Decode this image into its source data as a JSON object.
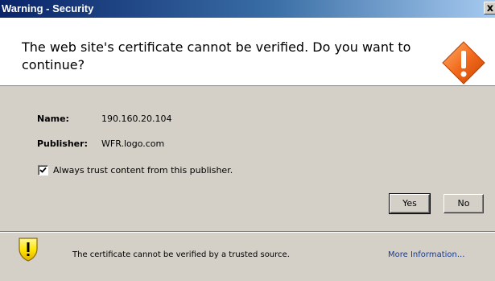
{
  "window": {
    "title": "Warning - Security",
    "close_label": "x"
  },
  "header": {
    "message": "The web site's certificate cannot be verified.  Do you want to continue?",
    "icon": "warning-diamond-icon"
  },
  "details": {
    "name_label": "Name:",
    "name_value": "190.160.20.104",
    "publisher_label": "Publisher:",
    "publisher_value": "WFR.logo.com"
  },
  "trust_checkbox": {
    "label": "Always trust content from this publisher.",
    "checked": true
  },
  "buttons": {
    "yes_label": "Yes",
    "no_label": "No"
  },
  "footer": {
    "icon": "warning-shield-icon",
    "message": "The certificate cannot be verified by a trusted source.",
    "link": "More Information..."
  },
  "colors": {
    "title_bar_start": "#0a246a",
    "title_bar_end": "#a6caf0",
    "dialog_background": "#d4d0c8",
    "warning_orange": "#f26b1d",
    "shield_yellow": "#ffe600",
    "link_blue": "#1a3b8c"
  }
}
